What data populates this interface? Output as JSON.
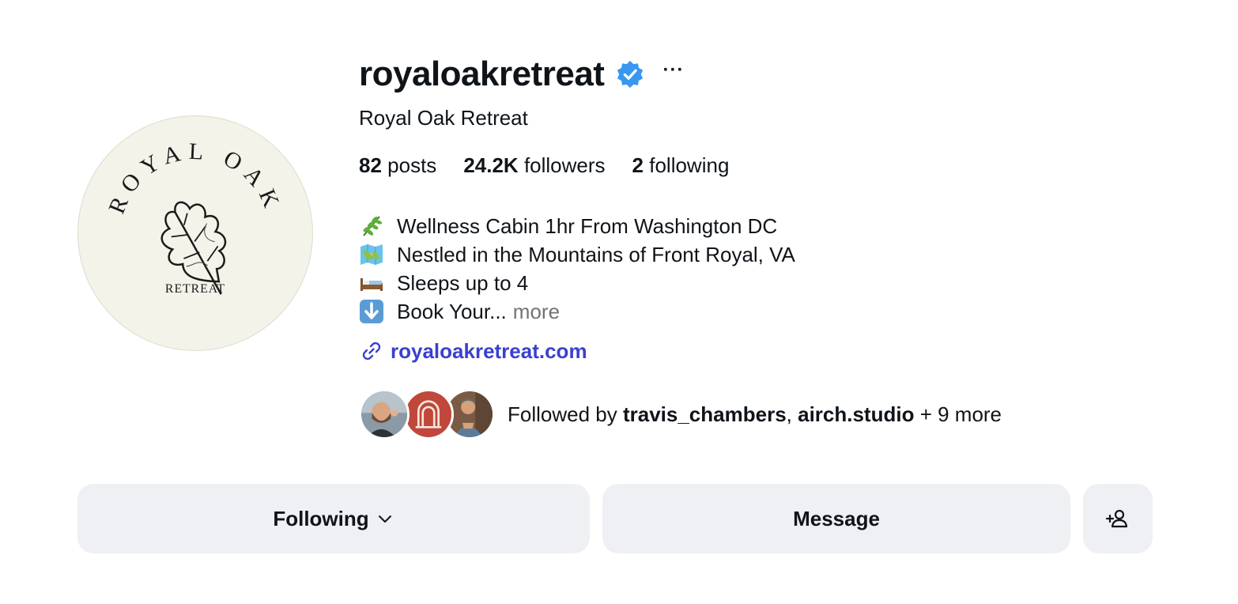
{
  "profile": {
    "username": "royaloakretreat",
    "display_name": "Royal Oak Retreat",
    "verified": true,
    "more_icon": "more-options-icon",
    "avatar_text": {
      "arc": "ROYAL OAK",
      "bottom": "RETREAT"
    }
  },
  "stats": {
    "posts_count": "82",
    "posts_label": "posts",
    "followers_count": "24.2K",
    "followers_label": "followers",
    "following_count": "2",
    "following_label": "following"
  },
  "bio": {
    "lines": [
      {
        "icon": "herb-icon",
        "text": "Wellness Cabin 1hr From Washington DC"
      },
      {
        "icon": "map-icon",
        "text": "Nestled in the Mountains of Front Royal, VA"
      },
      {
        "icon": "bed-icon",
        "text": "Sleeps up to 4"
      },
      {
        "icon": "down-arrow-icon",
        "text": "Book Your..."
      }
    ],
    "more_label": "more"
  },
  "link": {
    "icon": "link-icon",
    "text": "royaloakretreat.com"
  },
  "followed_by": {
    "prefix": "Followed by ",
    "users": [
      "travis_chambers",
      "airch.studio"
    ],
    "separator": ", ",
    "suffix": " + 9 more"
  },
  "actions": {
    "following_label": "Following",
    "message_label": "Message",
    "add_user_icon": "add-person-icon"
  },
  "colors": {
    "accent_link": "#3a3fd0",
    "verified_blue": "#3897f0",
    "button_bg": "#eff0f4",
    "muted_text": "#737373"
  }
}
